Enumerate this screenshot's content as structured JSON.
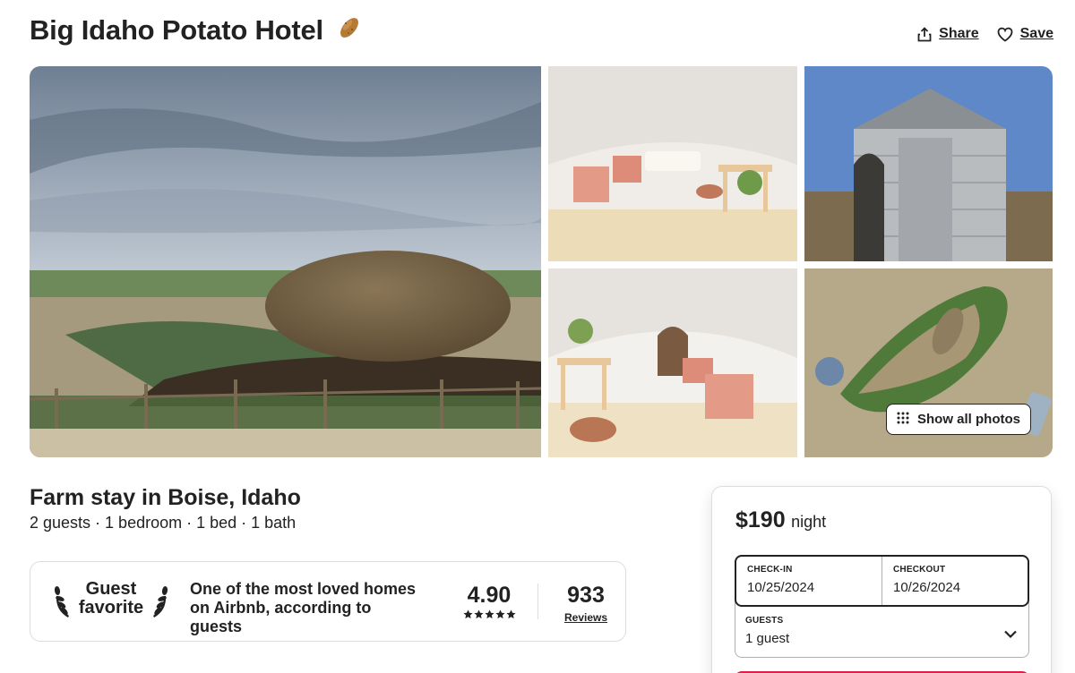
{
  "listing": {
    "title": "Big Idaho Potato Hotel",
    "title_emoji": "potato-emoji",
    "subtitle": "Farm stay in Boise, Idaho",
    "details": "2 guests · 1 bedroom · 1 bed · 1 bath"
  },
  "actions": {
    "share_label": "Share",
    "share_icon": "share-icon",
    "save_label": "Save",
    "save_icon": "heart-icon"
  },
  "gallery": {
    "photos": [
      {
        "name": "giant-potato-exterior-photo"
      },
      {
        "name": "potato-interior-bedroom-photo"
      },
      {
        "name": "grain-bin-exterior-photo"
      },
      {
        "name": "potato-interior-lounge-photo"
      },
      {
        "name": "aerial-property-photo"
      }
    ],
    "show_all_label": "Show all photos",
    "show_all_icon": "grid-icon"
  },
  "guest_favorite": {
    "label_line1": "Guest",
    "label_line2": "favorite",
    "description": "One of the most loved homes on Airbnb, according to guests",
    "rating": "4.90",
    "stars": 5,
    "reviews_count": "933",
    "reviews_label": "Reviews"
  },
  "booking": {
    "price": "$190",
    "per": "night",
    "checkin_label": "CHECK-IN",
    "checkin_value": "10/25/2024",
    "checkout_label": "CHECKOUT",
    "checkout_value": "10/26/2024",
    "guests_label": "GUESTS",
    "guests_value": "1 guest"
  },
  "colors": {
    "text": "#222222",
    "border": "#dddddd",
    "brand": "#e0204c"
  }
}
